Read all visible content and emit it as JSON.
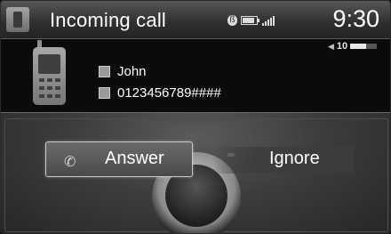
{
  "header": {
    "title": "Incoming call",
    "time": "9:30",
    "status_icons": [
      "bluetooth-icon",
      "battery-icon",
      "signal-icon"
    ]
  },
  "volume": {
    "level": "10"
  },
  "caller": {
    "name": "John",
    "number": "0123456789####"
  },
  "actions": {
    "answer_label": "Answer",
    "ignore_label": "Ignore"
  },
  "colors": {
    "background": "#0d0d0d",
    "header": "#2e2e2e",
    "panel": "#3d3d3d",
    "text": "#ffffff"
  }
}
